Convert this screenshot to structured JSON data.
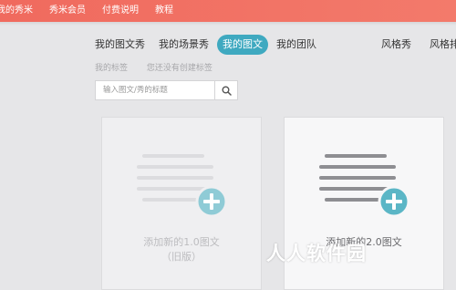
{
  "topbar": {
    "items": [
      "我的秀米",
      "秀米会员",
      "付费说明",
      "教程"
    ]
  },
  "tabs": {
    "items": [
      "我的图文秀",
      "我的场景秀",
      "我的图文",
      "我的团队"
    ],
    "active_index": 2,
    "right_items": [
      "风格秀",
      "风格排"
    ]
  },
  "tags": {
    "label": "我的标签",
    "empty_text": "您还没有创建标签"
  },
  "search": {
    "placeholder": "输入图文/秀的标题"
  },
  "cards": [
    {
      "label": "添加新的1.0图文",
      "sub": "（旧版）"
    },
    {
      "label": "添加新的2.0图文"
    }
  ],
  "watermark": "人人软件园",
  "colors": {
    "topbar": "#f06a5e",
    "accent": "#3fa9c0",
    "plus_circle": "#5bb6c6"
  }
}
